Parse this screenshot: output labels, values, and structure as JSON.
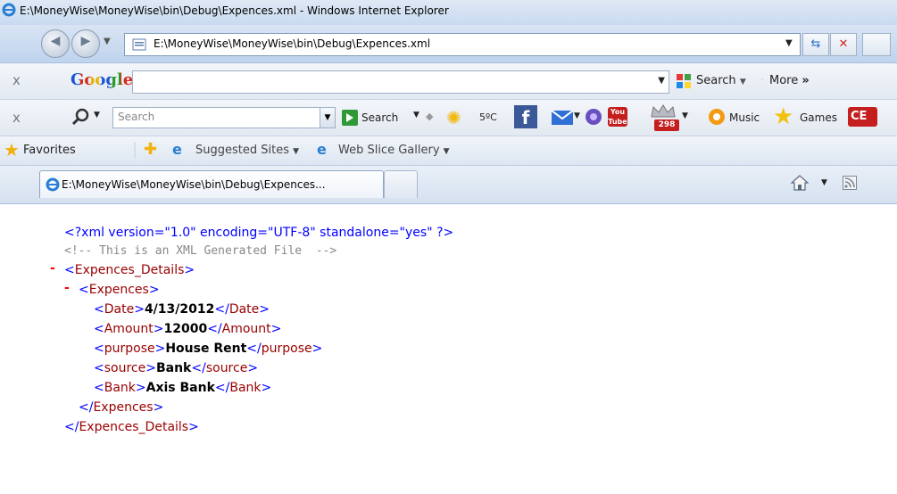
{
  "window": {
    "title": "E:\\MoneyWise\\MoneyWise\\bin\\Debug\\Expences.xml - Windows Internet Explorer"
  },
  "address_bar": {
    "url": "E:\\MoneyWise\\MoneyWise\\bin\\Debug\\Expences.xml"
  },
  "google_toolbar": {
    "logo": "Google",
    "search_label": "Search",
    "more_label": "More",
    "more_glyph": "»"
  },
  "tool_toolbar": {
    "search_placeholder": "Search",
    "search_button": "Search",
    "weather": "5ºC",
    "badge_count": "298",
    "music_label": "Music",
    "games_label": "Games",
    "cbs_label": "CE"
  },
  "favorites_bar": {
    "favorites_label": "Favorites",
    "suggested_sites": "Suggested Sites",
    "web_slice": "Web Slice Gallery"
  },
  "tab": {
    "title": "E:\\MoneyWise\\MoneyWise\\bin\\Debug\\Expences..."
  },
  "xml": {
    "declaration": "<?xml version=\"1.0\" encoding=\"UTF-8\" standalone=\"yes\" ?>",
    "comment": "<!-- This is an XML Generated File  -->",
    "root_tag": "Expences_Details",
    "record_tag": "Expences",
    "fields": [
      {
        "tag": "Date",
        "value": "4/13/2012"
      },
      {
        "tag": "Amount",
        "value": "12000"
      },
      {
        "tag": "purpose",
        "value": "House Rent"
      },
      {
        "tag": "source",
        "value": "Bank"
      },
      {
        "tag": "Bank",
        "value": "Axis Bank"
      }
    ],
    "collapse_glyph": "-"
  },
  "colors": {
    "markup_blue": "#0000ff",
    "tag_red": "#990000",
    "comment_gray": "#888888",
    "collapse_red": "#ff0000"
  }
}
